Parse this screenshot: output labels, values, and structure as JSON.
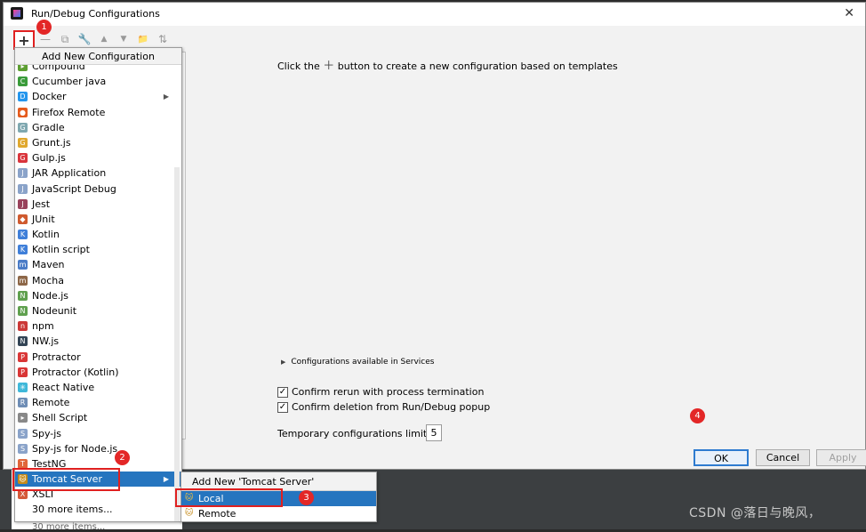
{
  "window": {
    "title": "Run/Debug Configurations",
    "close_glyph": "✕"
  },
  "toolbar": {
    "add_glyph": "+",
    "remove_glyph": "—",
    "copy_glyph": "⧉",
    "edit_glyph": "🔧",
    "up_glyph": "▲",
    "down_glyph": "▼",
    "folder_glyph": "📁",
    "sort_glyph": "⇅"
  },
  "badges": [
    "1",
    "2",
    "3",
    "4"
  ],
  "popup": {
    "header": "Add New Configuration",
    "items": [
      {
        "label": "Compound",
        "icon": "compound-icon",
        "color": "#5c9e31",
        "glyph": "▸"
      },
      {
        "label": "Cucumber java",
        "icon": "cucumber-icon",
        "color": "#3a9b3a",
        "glyph": "C"
      },
      {
        "label": "Docker",
        "icon": "docker-icon",
        "color": "#2496ed",
        "glyph": "D",
        "submenu": true
      },
      {
        "label": "Firefox Remote",
        "icon": "firefox-icon",
        "color": "#e55b1d",
        "glyph": "●"
      },
      {
        "label": "Gradle",
        "icon": "gradle-icon",
        "color": "#7fa8b0",
        "glyph": "G"
      },
      {
        "label": "Grunt.js",
        "icon": "grunt-icon",
        "color": "#e0a82e",
        "glyph": "G"
      },
      {
        "label": "Gulp.js",
        "icon": "gulp-icon",
        "color": "#d9353c",
        "glyph": "G"
      },
      {
        "label": "JAR Application",
        "icon": "jar-icon",
        "color": "#8aa3c9",
        "glyph": "J"
      },
      {
        "label": "JavaScript Debug",
        "icon": "js-debug-icon",
        "color": "#8aa3c9",
        "glyph": "J"
      },
      {
        "label": "Jest",
        "icon": "jest-icon",
        "color": "#99425b",
        "glyph": "J"
      },
      {
        "label": "JUnit",
        "icon": "junit-icon",
        "color": "#cf5a2f",
        "glyph": "◆"
      },
      {
        "label": "Kotlin",
        "icon": "kotlin-icon",
        "color": "#3f7fd9",
        "glyph": "K"
      },
      {
        "label": "Kotlin script",
        "icon": "kotlin-script-icon",
        "color": "#3f7fd9",
        "glyph": "K"
      },
      {
        "label": "Maven",
        "icon": "maven-icon",
        "color": "#4a7cc7",
        "glyph": "m"
      },
      {
        "label": "Mocha",
        "icon": "mocha-icon",
        "color": "#8d6748",
        "glyph": "m"
      },
      {
        "label": "Node.js",
        "icon": "nodejs-icon",
        "color": "#5fa04e",
        "glyph": "N"
      },
      {
        "label": "Nodeunit",
        "icon": "nodeunit-icon",
        "color": "#5fa04e",
        "glyph": "N"
      },
      {
        "label": "npm",
        "icon": "npm-icon",
        "color": "#cb3837",
        "glyph": "n"
      },
      {
        "label": "NW.js",
        "icon": "nwjs-icon",
        "color": "#334455",
        "glyph": "N"
      },
      {
        "label": "Protractor",
        "icon": "protractor-icon",
        "color": "#d93636",
        "glyph": "P"
      },
      {
        "label": "Protractor (Kotlin)",
        "icon": "protractor-kotlin-icon",
        "color": "#d93636",
        "glyph": "P"
      },
      {
        "label": "React Native",
        "icon": "react-icon",
        "color": "#3fb8d9",
        "glyph": "✳"
      },
      {
        "label": "Remote",
        "icon": "remote-icon",
        "color": "#6e8db5",
        "glyph": "R"
      },
      {
        "label": "Shell Script",
        "icon": "shell-icon",
        "color": "#888888",
        "glyph": "▸"
      },
      {
        "label": "Spy-js",
        "icon": "spyjs-icon",
        "color": "#8aa3c9",
        "glyph": "S"
      },
      {
        "label": "Spy-js for Node.js",
        "icon": "spyjs-node-icon",
        "color": "#8aa3c9",
        "glyph": "S"
      },
      {
        "label": "TestNG",
        "icon": "testng-icon",
        "color": "#e0663a",
        "glyph": "T"
      },
      {
        "label": "Tomcat Server",
        "icon": "tomcat-icon",
        "color": "#c58a18",
        "glyph": "🐱",
        "submenu": true,
        "selected": true
      },
      {
        "label": "XSLT",
        "icon": "xslt-icon",
        "color": "#d45a3a",
        "glyph": "X"
      },
      {
        "label": "30 more items...",
        "icon": "",
        "color": "",
        "glyph": ""
      }
    ]
  },
  "submenu": {
    "header": "Add New 'Tomcat Server' Configuration",
    "items": [
      {
        "label": "Local",
        "selected": true
      },
      {
        "label": "Remote",
        "selected": false
      }
    ]
  },
  "main": {
    "hint_before": "Click the",
    "hint_plus": "＋",
    "hint_after": "button to create a new configuration based on templates",
    "services": "Configurations available in Services",
    "confirm_rerun": "Confirm rerun with process termination",
    "confirm_delete": "Confirm deletion from Run/Debug popup",
    "temp_limit_label": "Temporary configurations limit:",
    "temp_limit_value": "5"
  },
  "buttons": {
    "ok": "OK",
    "cancel": "Cancel",
    "apply": "Apply"
  },
  "watermark": "CSDN @落日与晚风，",
  "ghost_text": "30 more items..."
}
